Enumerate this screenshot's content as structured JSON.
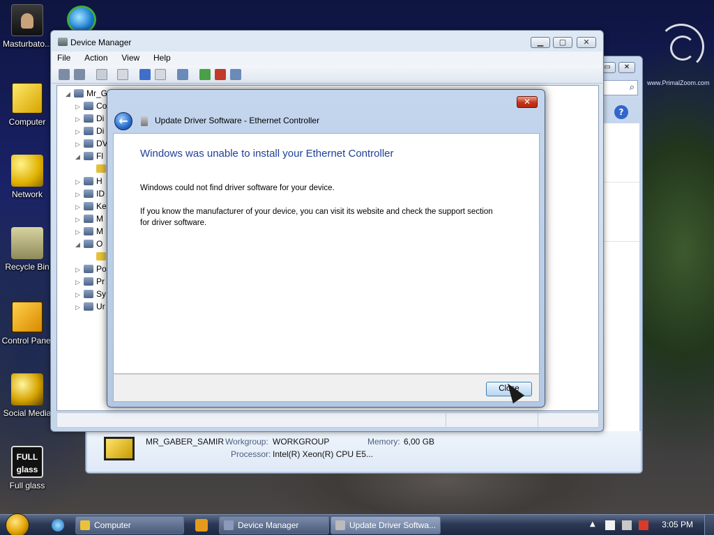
{
  "desktop": {
    "icons": [
      {
        "label": "Masturbato..."
      },
      {
        "label": "Computer"
      },
      {
        "label": "Network"
      },
      {
        "label": "Recycle Bin"
      },
      {
        "label": "Control Panel"
      },
      {
        "label": "Social Media"
      },
      {
        "label": "Full glass"
      }
    ],
    "full_glass_badge_top": "FULL",
    "full_glass_badge_bottom": "glass",
    "watermark": "www.PrimalZoom.com"
  },
  "computer_window": {
    "computer_name": "MR_GABER_SAMIR",
    "workgroup_label": "Workgroup:",
    "workgroup_value": "WORKGROUP",
    "memory_label": "Memory:",
    "memory_value": "6,00 GB",
    "processor_label": "Processor:",
    "processor_value": "Intel(R) Xeon(R) CPU E5..."
  },
  "device_manager": {
    "title": "Device Manager",
    "menu": [
      "File",
      "Action",
      "View",
      "Help"
    ],
    "tree_root": "Mr_Ga",
    "tree_items": [
      "Co",
      "Di",
      "Di",
      "DV",
      "Fl",
      "",
      "H",
      "ID",
      "Ke",
      "M",
      "M",
      "O",
      "",
      "Po",
      "Pr",
      "Sy",
      "Ur"
    ]
  },
  "dialog": {
    "title": "Update Driver Software - Ethernet Controller",
    "heading": "Windows was unable to install your Ethernet Controller",
    "paragraph1": "Windows could not find driver software for your device.",
    "paragraph2": "If you know the manufacturer of your device, you can visit its website and check the support section for driver software.",
    "close_button": "Close",
    "close_x": "✕"
  },
  "taskbar": {
    "tasks": [
      {
        "label": "Computer"
      },
      {
        "label": "Device Manager"
      },
      {
        "label": "Update Driver Softwa..."
      }
    ],
    "clock": "3:05 PM"
  }
}
